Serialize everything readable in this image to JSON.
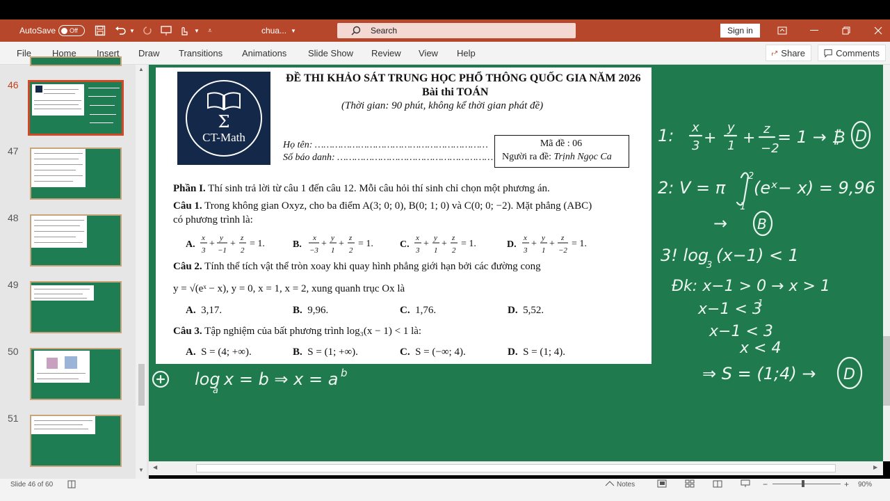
{
  "titlebar": {
    "autosave_label": "AutoSave",
    "autosave_state": "Off",
    "doc_name": "chua...",
    "search_placeholder": "Search",
    "signin_label": "Sign in"
  },
  "menu": [
    "File",
    "Home",
    "Insert",
    "Draw",
    "Transitions",
    "Animations",
    "Slide Show",
    "Review",
    "View",
    "Help"
  ],
  "share_label": "Share",
  "comments_label": "Comments",
  "slides": [
    {
      "num": "46",
      "selected": true
    },
    {
      "num": "47"
    },
    {
      "num": "48"
    },
    {
      "num": "49"
    },
    {
      "num": "50"
    },
    {
      "num": "51"
    }
  ],
  "exam": {
    "logo_text": "CT-Math",
    "title": "ĐỀ THI KHẢO SÁT TRUNG HỌC PHỔ THÔNG QUỐC GIA NĂM 2026",
    "subject": "Bài thi TOÁN",
    "time_note": "(Thời gian: 90 phút, không kể thời gian phát đề)",
    "name_line": "Họ tên: ……………………………………………………",
    "id_line": "Số báo danh: ………………………………………………",
    "code": "Mã đề : 06",
    "author_label": "Người ra đề:",
    "author_name": "Trịnh Ngọc Ca",
    "part_title": "Phần I.",
    "part_desc": "Thí sinh trả lời từ câu 1 đến câu 12. Mỗi câu hỏi thí sinh chỉ chọn một phương án.",
    "q1_label": "Câu 1.",
    "q1_text": "Trong không gian Oxyz, cho ba điểm A(3; 0; 0), B(0; 1; 0) và C(0; 0; −2). Mặt phẳng (ABC)",
    "q1_text2": "có phương trình là:",
    "q2_label": "Câu 2.",
    "q2_text": "Tính thể tích vật thể tròn xoay khi quay hình phẳng giới hạn bởi các đường cong",
    "q2_text2": "y = √(eˣ − x), y = 0, x = 1, x = 2, xung quanh trục Ox là",
    "q2_answers": [
      "3,17.",
      "9,96.",
      "1,76.",
      "5,52."
    ],
    "q3_label": "Câu 3.",
    "q3_text": "Tập nghiệm của bất phương trình log₃(x − 1) < 1 là:",
    "q3_answers": [
      "S = (4; +∞).",
      "S = (1; +∞).",
      "S = (−∞; 4).",
      "S = (1; 4)."
    ],
    "letters": [
      "A.",
      "B.",
      "C.",
      "D."
    ]
  },
  "status": {
    "slide_info": "Slide 46 of 60",
    "notes_label": "Notes",
    "zoom": "90%"
  }
}
